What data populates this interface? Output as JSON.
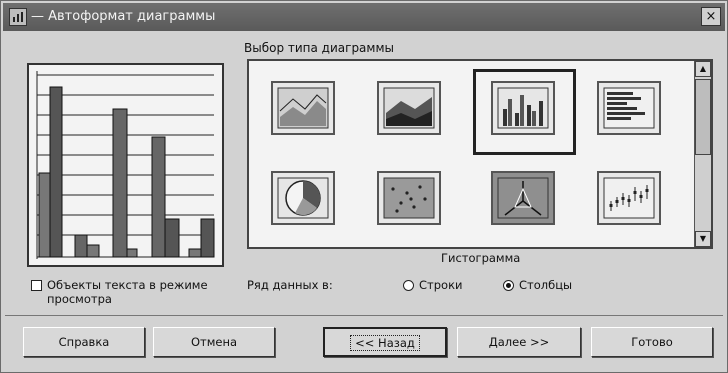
{
  "window": {
    "title": "— Автоформат диаграммы",
    "close": "×"
  },
  "preview": {
    "show_text_checkbox": {
      "label": "Объекты текста в режиме просмотра",
      "checked": false
    }
  },
  "chart_type_group": {
    "label": "Выбор типа диаграммы",
    "tiles": [
      {
        "name": "area",
        "selected": false
      },
      {
        "name": "stacked-area",
        "selected": false
      },
      {
        "name": "column",
        "selected": true
      },
      {
        "name": "bar",
        "selected": false
      },
      {
        "name": "pie",
        "selected": false
      },
      {
        "name": "scatter",
        "selected": false
      },
      {
        "name": "radar",
        "selected": false
      },
      {
        "name": "stock",
        "selected": false
      }
    ],
    "selected_type_name": "Гистограмма"
  },
  "series_in": {
    "label": "Ряд данных в:",
    "options": [
      {
        "label": "Строки",
        "selected": false
      },
      {
        "label": "Столбцы",
        "selected": true
      }
    ]
  },
  "buttons": {
    "help": "Справка",
    "cancel": "Отмена",
    "back": "<< Назад",
    "next": "Далее >>",
    "finish": "Готово"
  },
  "colors": {
    "titlebar": "#5e5e5e",
    "dialog": "#d2d2d2",
    "selected_frame": "#222222"
  }
}
